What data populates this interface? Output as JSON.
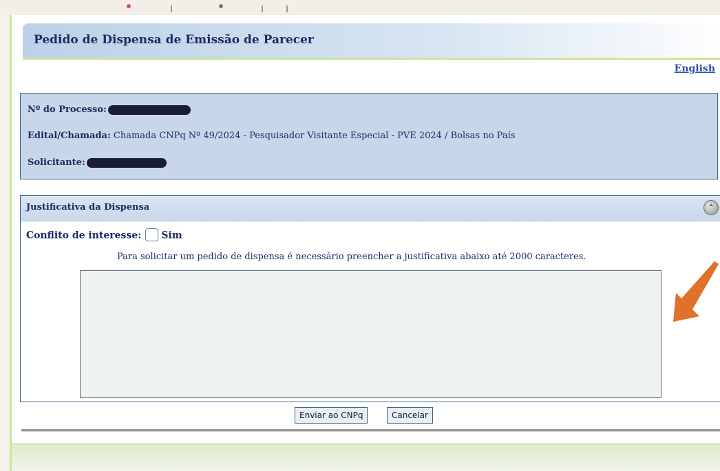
{
  "header": {
    "title": "Pedido de Dispensa de Emissão de Parecer"
  },
  "language_link": "English",
  "info": {
    "processo_label": "Nº do Processo:",
    "edital_label": "Edital/Chamada:",
    "edital_value": "Chamada CNPq Nº 49/2024 - Pesquisador Visitante Especial - PVE 2024 / Bolsas no País",
    "solicitante_label": "Solicitante:"
  },
  "justificativa": {
    "title": "Justificativa da Dispensa",
    "collapse_symbol": "⌃",
    "conflict_label": "Conflito de interesse:",
    "conflict_option": "Sim",
    "conflict_checked": false,
    "instruction": "Para solicitar um pedido de dispensa é necessário preencher a justificativa abaixo até 2000 caracteres.",
    "text_value": ""
  },
  "buttons": {
    "send": "Enviar ao CNPq",
    "cancel": "Cancelar"
  },
  "colors": {
    "accent_green": "#cfe49a",
    "panel_blue": "#c8d6ea",
    "text_navy": "#1c2a64",
    "arrow_orange": "#e0702a"
  }
}
